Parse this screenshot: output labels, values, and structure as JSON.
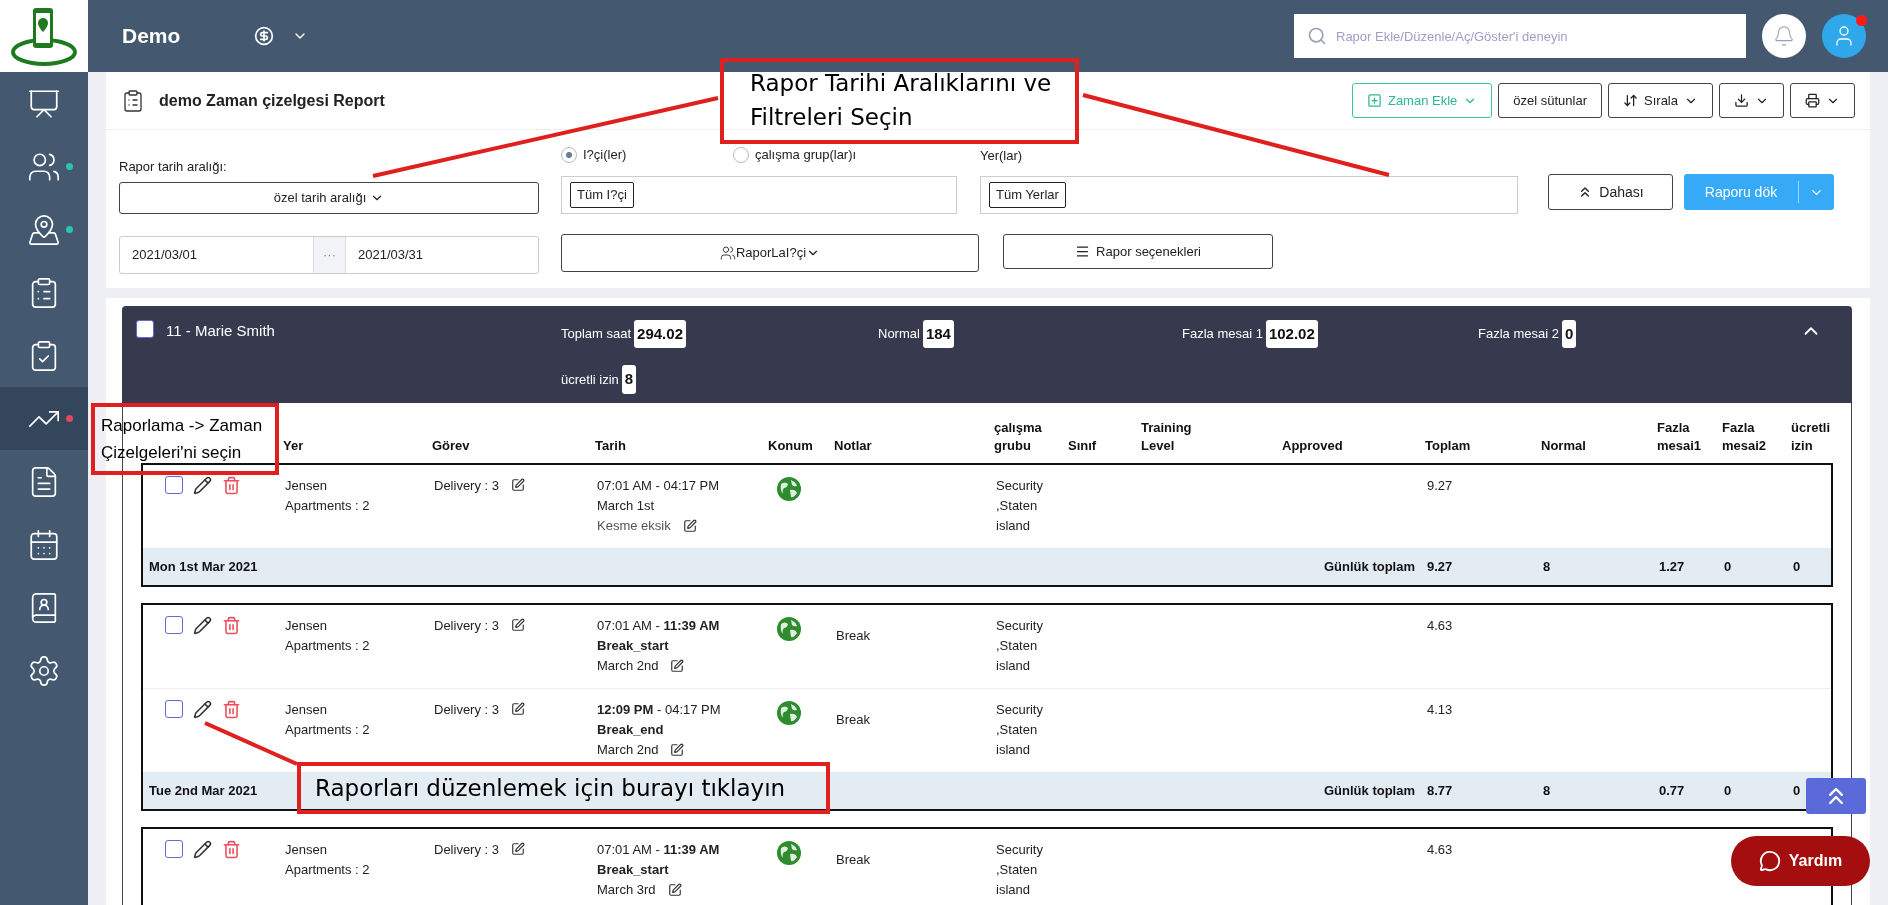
{
  "app": {
    "name": "Demo"
  },
  "sidebar": {
    "items": [
      {
        "selected": false
      },
      {
        "selected": false,
        "color": "#2ec4a5"
      },
      {
        "selected": false,
        "color": "#2ec4a5"
      },
      {
        "selected": false
      },
      {
        "selected": false
      },
      {
        "selected": true,
        "color": "#e0495f"
      },
      {
        "selected": false
      },
      {
        "selected": false
      },
      {
        "selected": false
      },
      {
        "selected": false
      }
    ]
  },
  "search": {
    "placeholder": "Rapor Ekle/Düzenle/Aç/Göster'i deneyin"
  },
  "user": {
    "alert": true
  },
  "report": {
    "title": "demo Zaman çizelgesi Report",
    "toolbar": [
      {
        "kind": "add",
        "label": "Zaman Ekle"
      },
      {
        "kind": "plain",
        "label": "özel sütunlar"
      },
      {
        "kind": "sort",
        "label": "Sırala"
      },
      {
        "kind": "download"
      },
      {
        "kind": "print"
      }
    ]
  },
  "filters": {
    "date_range_label": "Rapor tarih aralığı:",
    "range_preset": "özel tarih aralığı",
    "start": "2021/03/01",
    "separator": "···",
    "end": "2021/03/31",
    "scope_options": [
      {
        "label": "I?çi(ler)",
        "selected": true
      },
      {
        "label": "çalışma grup(lar)ı",
        "selected": false
      }
    ],
    "employee_tag": "Tüm I?çi",
    "report_by": "RaporLaI?çi",
    "locations_label": "Yer(lar)",
    "location_tag": "Tüm Yerlar",
    "options_button": "Rapor seçenekleri",
    "more_button": "Dahası",
    "run_button": "Raporu dök"
  },
  "employee": {
    "checked": false,
    "name": "11 - Marie Smith",
    "expanded": true,
    "stats": [
      {
        "label": "Toplam saat",
        "value": "294.02"
      },
      {
        "label": "Normal",
        "value": "184"
      },
      {
        "label": "Fazla mesai 1",
        "value": "102.02"
      },
      {
        "label": "Fazla mesai 2",
        "value": "0"
      },
      {
        "label": "ücretli izin",
        "value": "8"
      }
    ]
  },
  "table": {
    "columns": [
      "Yer",
      "Görev",
      "Tarih",
      "Konum",
      "Notlar",
      "çalışma grubu",
      "Sınıf",
      "Training Level",
      "Approved",
      "Toplam",
      "Normal",
      "Fazla mesai1",
      "Fazla mesai2",
      "ücretli izin"
    ],
    "groups": [
      {
        "rows": [
          {
            "checked": false,
            "location": "Jensen Apartments : 2",
            "task": "Delivery : 3",
            "time": "07:01 AM - 04:17 PM",
            "lines": [
              "March 1st",
              "Kesme eksik"
            ],
            "notes": "",
            "work_group": "Security ,Staten island",
            "total": "9.27"
          }
        ],
        "summary": {
          "date": "Mon 1st Mar 2021",
          "label": "Günlük toplam",
          "values": [
            "9.27",
            "8",
            "1.27",
            "0",
            "0"
          ]
        }
      },
      {
        "rows": [
          {
            "checked": false,
            "location": "Jensen Apartments : 2",
            "task": "Delivery : 3",
            "time": "07:01 AM - **11:39 AM**",
            "event": "Break_start",
            "lines": [
              "March 2nd"
            ],
            "notes": "Break",
            "work_group": "Security ,Staten island",
            "total": "4.63"
          },
          {
            "checked": false,
            "location": "Jensen Apartments : 2",
            "task": "Delivery : 3",
            "time": "**12:09 PM** - 04:17 PM",
            "event": "Break_end",
            "lines": [
              "March 2nd"
            ],
            "notes": "Break",
            "work_group": "Security ,Staten island",
            "total": "4.13"
          }
        ],
        "summary": {
          "date": "Tue 2nd Mar 2021",
          "label": "Günlük toplam",
          "values": [
            "8.77",
            "8",
            "0.77",
            "0",
            "0"
          ]
        }
      },
      {
        "rows": [
          {
            "checked": false,
            "location": "Jensen Apartments : 2",
            "task": "Delivery : 3",
            "time": "07:01 AM - **11:39 AM**",
            "event": "Break_start",
            "lines": [
              "March 3rd"
            ],
            "notes": "Break",
            "work_group": "Security ,Staten island",
            "total": "4.63"
          }
        ]
      }
    ]
  },
  "annotations": [
    {
      "text": "Rapor Tarihi Aralıklarını ve Filtreleri Seçin"
    },
    {
      "text": "Raporlama -> Zaman Çizelgeleri'ni seçin"
    },
    {
      "text": "Raporları düzenlemek için burayı tıklayın"
    }
  ],
  "help_button": "Yardım"
}
